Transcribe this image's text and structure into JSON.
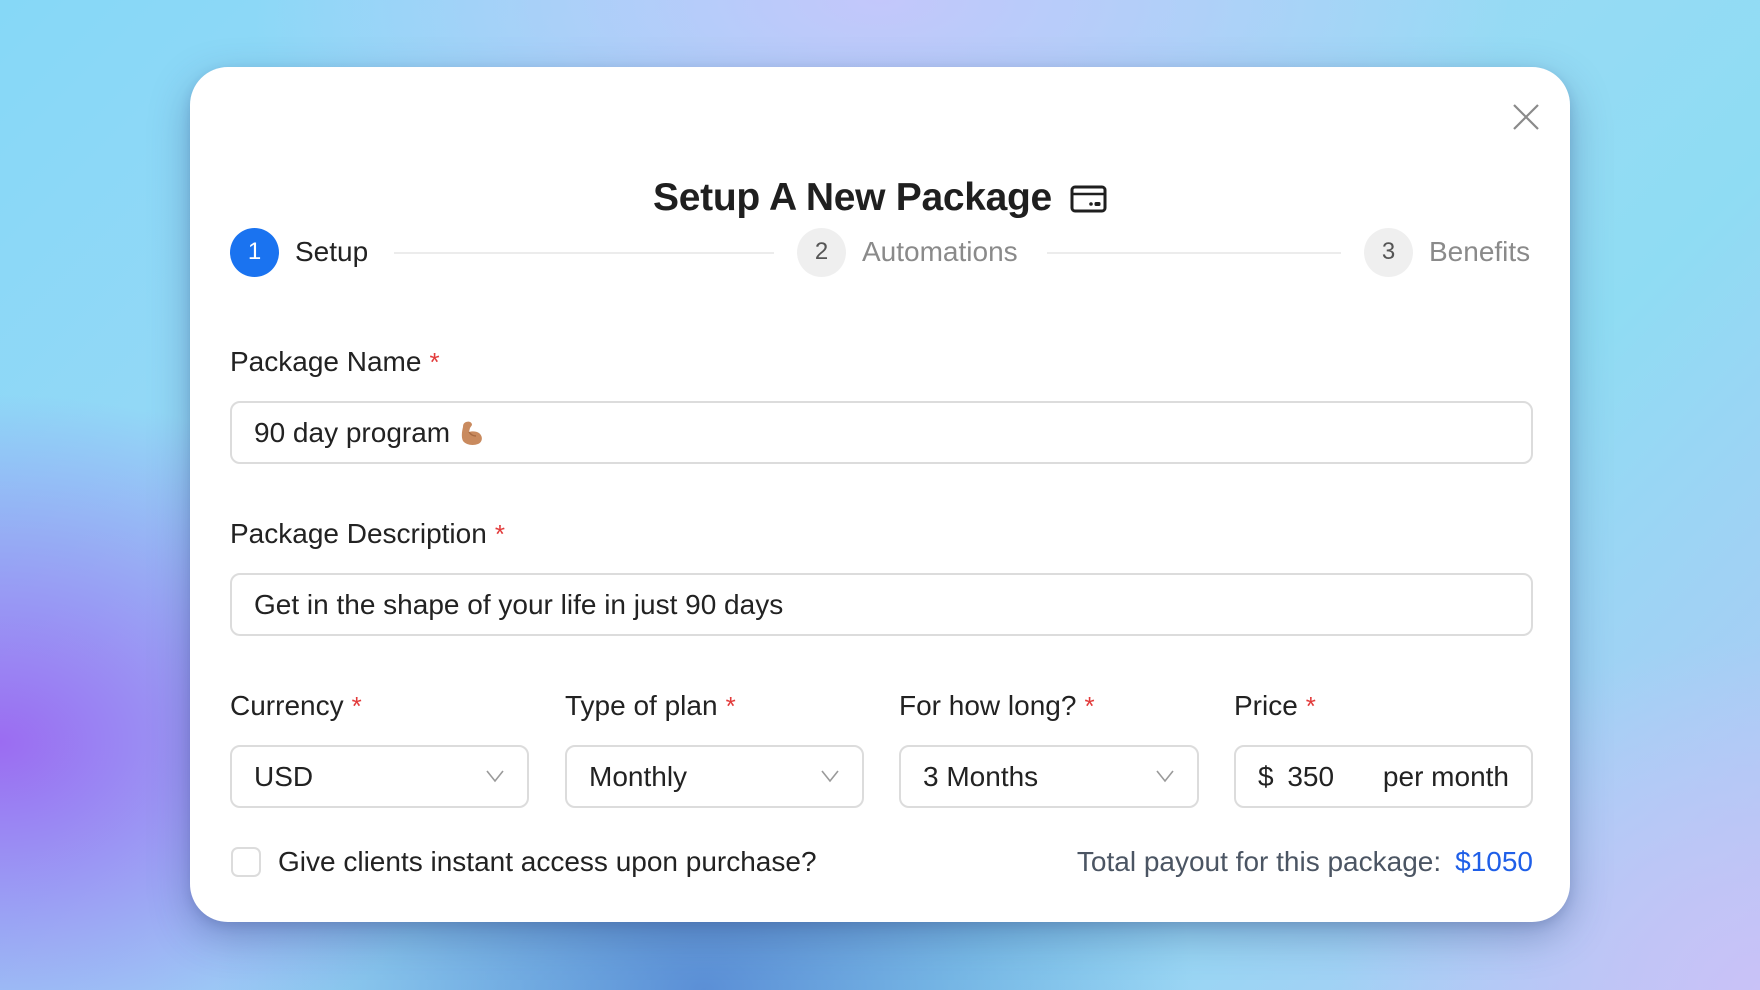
{
  "dialog": {
    "title": "Setup A New Package",
    "title_icon": "credit-card-icon",
    "close_icon": "close-icon"
  },
  "stepper": {
    "steps": [
      {
        "number": "1",
        "label": "Setup",
        "active": true
      },
      {
        "number": "2",
        "label": "Automations",
        "active": false
      },
      {
        "number": "3",
        "label": "Benefits",
        "active": false
      }
    ]
  },
  "form": {
    "required_marker": "*",
    "package_name": {
      "label": "Package Name",
      "value": "90 day program",
      "emoji": "flexed-biceps"
    },
    "package_description": {
      "label": "Package Description",
      "value": "Get in the shape of your life in just 90 days"
    },
    "currency": {
      "label": "Currency",
      "value": "USD"
    },
    "plan_type": {
      "label": "Type of plan",
      "value": "Monthly"
    },
    "duration": {
      "label": "For how long?",
      "value": "3 Months"
    },
    "price": {
      "label": "Price",
      "currency_symbol": "$",
      "value": "350",
      "suffix": "per month"
    },
    "instant_access": {
      "label": "Give clients instant access upon purchase?",
      "checked": false
    }
  },
  "summary": {
    "label": "Total payout for this package:",
    "amount": "$1050"
  },
  "colors": {
    "accent": "#1a73f0",
    "required": "#e23b3b",
    "amount": "#1f5fe8"
  }
}
